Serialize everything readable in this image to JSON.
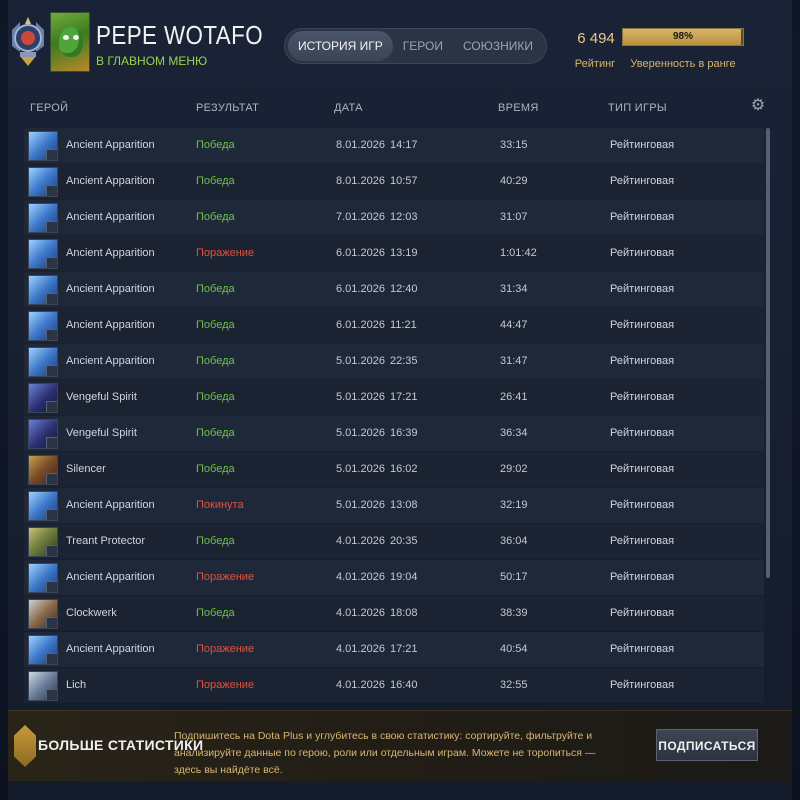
{
  "player": {
    "name": "PEPE WOTAFO",
    "status": "В ГЛАВНОМ МЕНЮ"
  },
  "tabs": [
    {
      "label": "ИСТОРИЯ ИГР",
      "active": true
    },
    {
      "label": "ГЕРОИ",
      "active": false
    },
    {
      "label": "СОЮЗНИКИ",
      "active": false
    }
  ],
  "rating": {
    "value": "6 494",
    "label": "Рейтинг"
  },
  "confidence": {
    "percent_label": "98%",
    "percent": 98,
    "label": "Уверенность в ранге"
  },
  "columns": {
    "hero": "ГЕРОЙ",
    "result": "РЕЗУЛЬТАТ",
    "date": "ДАТА",
    "duration": "ВРЕМЯ",
    "mode": "ТИП ИГРЫ"
  },
  "colors": {
    "win": "#6cc24a",
    "loss": "#e0533f",
    "abandon": "#e0533f",
    "accent_gold": "#d8b46a"
  },
  "matches": [
    {
      "hero": "Ancient Apparition",
      "hero_icon": "ancient-apparition",
      "result": "Победа",
      "result_type": "win",
      "date": "8.01.2026",
      "time": "14:17",
      "duration": "33:15",
      "mode": "Рейтинговая"
    },
    {
      "hero": "Ancient Apparition",
      "hero_icon": "ancient-apparition",
      "result": "Победа",
      "result_type": "win",
      "date": "8.01.2026",
      "time": "10:57",
      "duration": "40:29",
      "mode": "Рейтинговая"
    },
    {
      "hero": "Ancient Apparition",
      "hero_icon": "ancient-apparition",
      "result": "Победа",
      "result_type": "win",
      "date": "7.01.2026",
      "time": "12:03",
      "duration": "31:07",
      "mode": "Рейтинговая"
    },
    {
      "hero": "Ancient Apparition",
      "hero_icon": "ancient-apparition",
      "result": "Поражение",
      "result_type": "loss",
      "date": "6.01.2026",
      "time": "13:19",
      "duration": "1:01:42",
      "mode": "Рейтинговая"
    },
    {
      "hero": "Ancient Apparition",
      "hero_icon": "ancient-apparition",
      "result": "Победа",
      "result_type": "win",
      "date": "6.01.2026",
      "time": "12:40",
      "duration": "31:34",
      "mode": "Рейтинговая"
    },
    {
      "hero": "Ancient Apparition",
      "hero_icon": "ancient-apparition",
      "result": "Победа",
      "result_type": "win",
      "date": "6.01.2026",
      "time": "11:21",
      "duration": "44:47",
      "mode": "Рейтинговая"
    },
    {
      "hero": "Ancient Apparition",
      "hero_icon": "ancient-apparition",
      "result": "Победа",
      "result_type": "win",
      "date": "5.01.2026",
      "time": "22:35",
      "duration": "31:47",
      "mode": "Рейтинговая"
    },
    {
      "hero": "Vengeful Spirit",
      "hero_icon": "vengeful-spirit",
      "result": "Победа",
      "result_type": "win",
      "date": "5.01.2026",
      "time": "17:21",
      "duration": "26:41",
      "mode": "Рейтинговая"
    },
    {
      "hero": "Vengeful Spirit",
      "hero_icon": "vengeful-spirit",
      "result": "Победа",
      "result_type": "win",
      "date": "5.01.2026",
      "time": "16:39",
      "duration": "36:34",
      "mode": "Рейтинговая"
    },
    {
      "hero": "Silencer",
      "hero_icon": "silencer",
      "result": "Победа",
      "result_type": "win",
      "date": "5.01.2026",
      "time": "16:02",
      "duration": "29:02",
      "mode": "Рейтинговая"
    },
    {
      "hero": "Ancient Apparition",
      "hero_icon": "ancient-apparition",
      "result": "Покинута",
      "result_type": "abandon",
      "date": "5.01.2026",
      "time": "13:08",
      "duration": "32:19",
      "mode": "Рейтинговая"
    },
    {
      "hero": "Treant Protector",
      "hero_icon": "treant-protector",
      "result": "Победа",
      "result_type": "win",
      "date": "4.01.2026",
      "time": "20:35",
      "duration": "36:04",
      "mode": "Рейтинговая"
    },
    {
      "hero": "Ancient Apparition",
      "hero_icon": "ancient-apparition",
      "result": "Поражение",
      "result_type": "loss",
      "date": "4.01.2026",
      "time": "19:04",
      "duration": "50:17",
      "mode": "Рейтинговая"
    },
    {
      "hero": "Clockwerk",
      "hero_icon": "clockwerk",
      "result": "Победа",
      "result_type": "win",
      "date": "4.01.2026",
      "time": "18:08",
      "duration": "38:39",
      "mode": "Рейтинговая"
    },
    {
      "hero": "Ancient Apparition",
      "hero_icon": "ancient-apparition",
      "result": "Поражение",
      "result_type": "loss",
      "date": "4.01.2026",
      "time": "17:21",
      "duration": "40:54",
      "mode": "Рейтинговая"
    },
    {
      "hero": "Lich",
      "hero_icon": "lich",
      "result": "Поражение",
      "result_type": "loss",
      "date": "4.01.2026",
      "time": "16:40",
      "duration": "32:55",
      "mode": "Рейтинговая"
    }
  ],
  "footer": {
    "title": "БОЛЬШЕ СТАТИСТИКИ",
    "text": "Подпишитесь на Dota Plus и углубитесь в свою статистику: сортируйте, фильтруйте и анализируйте данные по герою, роли или отдельным играм. Можете не торопиться — здесь вы найдёте всё.",
    "button": "ПОДПИСАТЬСЯ"
  }
}
